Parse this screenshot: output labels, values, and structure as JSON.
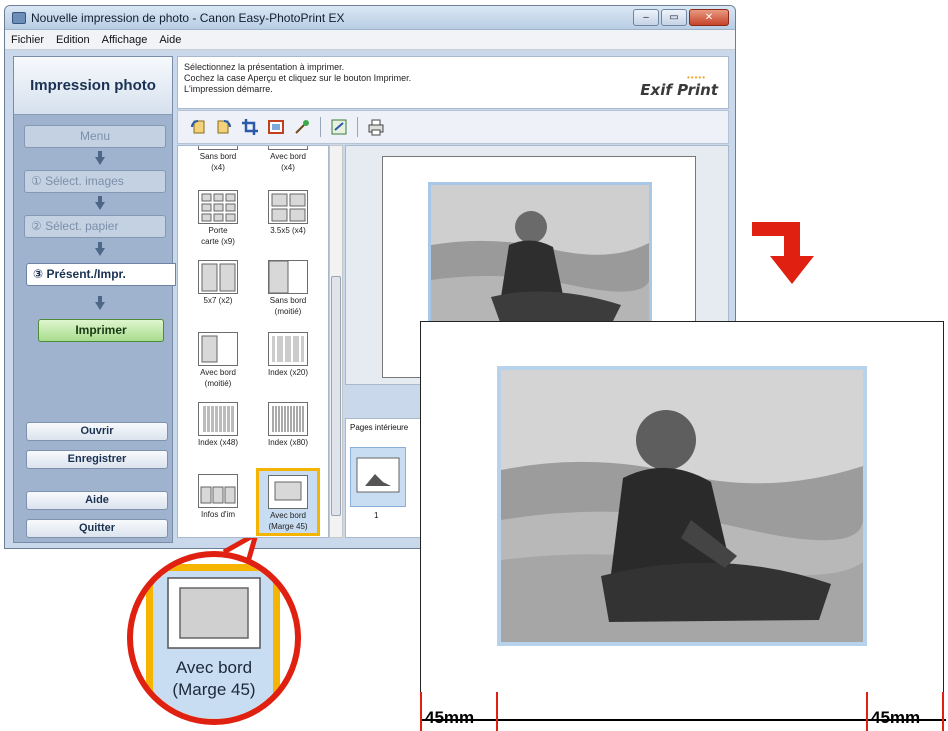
{
  "window": {
    "title": "Nouvelle impression de photo - Canon Easy-PhotoPrint EX",
    "minimize": "–",
    "maximize": "▭",
    "close": "✕"
  },
  "menu": [
    "Fichier",
    "Edition",
    "Affichage",
    "Aide"
  ],
  "sidebar": {
    "title": "Impression photo",
    "steps": {
      "menu": "Menu",
      "select_images": "① Sélect. images",
      "select_paper": "② Sélect. papier",
      "layout_print": "③ Présent./Impr."
    },
    "print_button": "Imprimer",
    "buttons": {
      "open": "Ouvrir",
      "save": "Enregistrer",
      "help": "Aide",
      "quit": "Quitter"
    }
  },
  "instructions": {
    "lines": [
      "Sélectionnez la présentation à imprimer.",
      "Cochez la case Aperçu et cliquez sur le bouton Imprimer.",
      "L'impression démarre."
    ],
    "logo": "Exif Print"
  },
  "toolbar": {
    "icons": [
      "rotate-left-icon",
      "rotate-right-icon",
      "crop-icon",
      "frame-icon",
      "effects-icon",
      "text-icon",
      "print-settings-icon"
    ]
  },
  "layouts": [
    {
      "label1": "Sans bord",
      "label2": "(x4)"
    },
    {
      "label1": "Avec bord",
      "label2": "(x4)"
    },
    {
      "label1": "Porte",
      "label2": "carte (x9)"
    },
    {
      "label1": "3.5x5 (x4)",
      "label2": ""
    },
    {
      "label1": "5x7 (x2)",
      "label2": ""
    },
    {
      "label1": "Sans bord",
      "label2": "(moitié)"
    },
    {
      "label1": "Avec bord",
      "label2": "(moitié)"
    },
    {
      "label1": "Index (x20)",
      "label2": ""
    },
    {
      "label1": "Index (x48)",
      "label2": ""
    },
    {
      "label1": "Index (x80)",
      "label2": ""
    },
    {
      "label1": "Infos d'im",
      "label2": ""
    },
    {
      "label1": "Avec bord",
      "label2": "(Marge 45)"
    }
  ],
  "pages": {
    "tab": "Pages intérieure",
    "page_number": "1"
  },
  "callout": {
    "line1": "Avec bord",
    "line2": "(Marge 45)"
  },
  "zoom": {
    "margin_left": "45mm",
    "margin_right": "45mm"
  },
  "colors": {
    "selection": "#f4b400",
    "callout_ring": "#e02010",
    "red_arrow": "#e02010",
    "photo_border": "#b8d2ec"
  }
}
